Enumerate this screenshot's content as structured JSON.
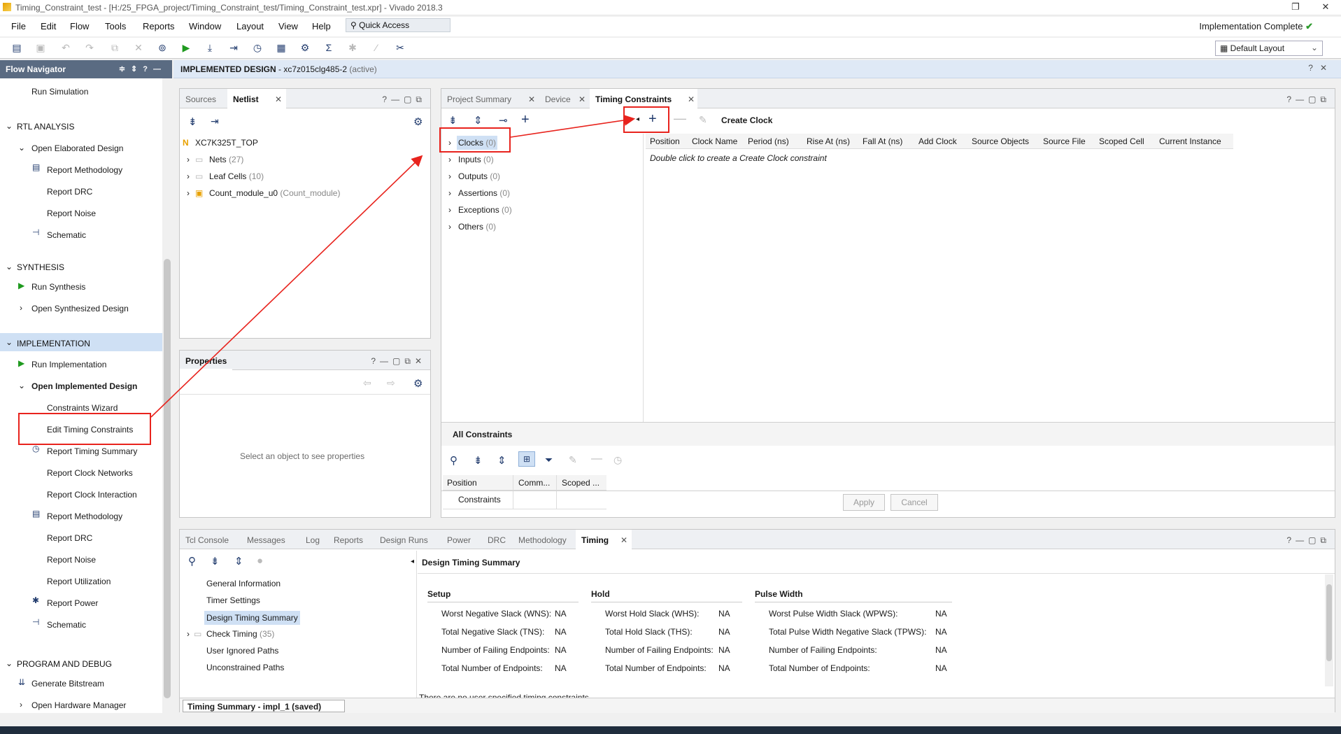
{
  "window": {
    "title": "Timing_Constraint_test - [H:/25_FPGA_project/Timing_Constraint_test/Timing_Constraint_test.xpr] - Vivado 2018.3",
    "restore_glyph": "❐",
    "close_glyph": "✕"
  },
  "menu": [
    "File",
    "Edit",
    "Flow",
    "Tools",
    "Reports",
    "Window",
    "Layout",
    "View",
    "Help"
  ],
  "quick_access": "Quick Access",
  "status": "Implementation Complete",
  "layout_select": "Default Layout",
  "flow_navigator": {
    "title": "Flow Navigator",
    "items": {
      "run_simulation": "Run Simulation",
      "rtl_analysis": "RTL ANALYSIS",
      "open_elaborated": "Open Elaborated Design",
      "rtl_report_methodology": "Report Methodology",
      "rtl_report_drc": "Report DRC",
      "rtl_report_noise": "Report Noise",
      "rtl_schematic": "Schematic",
      "synthesis": "SYNTHESIS",
      "run_synthesis": "Run Synthesis",
      "open_synthesized": "Open Synthesized Design",
      "implementation": "IMPLEMENTATION",
      "run_implementation": "Run Implementation",
      "open_implemented": "Open Implemented Design",
      "constraints_wizard": "Constraints Wizard",
      "edit_timing_constraints": "Edit Timing Constraints",
      "report_timing_summary": "Report Timing Summary",
      "report_clock_networks": "Report Clock Networks",
      "report_clock_interaction": "Report Clock Interaction",
      "impl_report_methodology": "Report Methodology",
      "impl_report_drc": "Report DRC",
      "impl_report_noise": "Report Noise",
      "report_utilization": "Report Utilization",
      "report_power": "Report Power",
      "impl_schematic": "Schematic",
      "program_debug": "PROGRAM AND DEBUG",
      "generate_bitstream": "Generate Bitstream",
      "open_hw_manager": "Open Hardware Manager"
    }
  },
  "design_header": {
    "label": "IMPLEMENTED DESIGN",
    "part": " - xc7z015clg485-2",
    "state": " (active)"
  },
  "sources_panel": {
    "tabs": [
      "Sources",
      "Netlist"
    ],
    "top": "XC7K325T_TOP",
    "nets": "Nets",
    "nets_count": "(27)",
    "leaf": "Leaf Cells",
    "leaf_count": "(10)",
    "module": "Count_module_u0",
    "module_sub": "(Count_module)"
  },
  "properties_panel": {
    "title": "Properties",
    "empty": "Select an object to see properties"
  },
  "timing_panel": {
    "tabs": [
      "Project Summary",
      "Device",
      "Timing Constraints"
    ],
    "create_clock": "Create Clock",
    "categories": [
      {
        "name": "Clocks",
        "count": "(0)"
      },
      {
        "name": "Inputs",
        "count": "(0)"
      },
      {
        "name": "Outputs",
        "count": "(0)"
      },
      {
        "name": "Assertions",
        "count": "(0)"
      },
      {
        "name": "Exceptions",
        "count": "(0)"
      },
      {
        "name": "Others",
        "count": "(0)"
      }
    ],
    "columns": [
      "Position",
      "Clock Name",
      "Period (ns)",
      "Rise At (ns)",
      "Fall At (ns)",
      "Add Clock",
      "Source Objects",
      "Source File",
      "Scoped Cell",
      "Current Instance"
    ],
    "hint": "Double click to create a Create Clock constraint",
    "all_constraints": "All Constraints",
    "ac_columns": [
      "Position",
      "Comm...",
      "Scoped ..."
    ],
    "ac_row": "Constraints",
    "apply": "Apply",
    "cancel": "Cancel"
  },
  "bottom_panel": {
    "tabs": [
      "Tcl Console",
      "Messages",
      "Log",
      "Reports",
      "Design Runs",
      "Power",
      "DRC",
      "Methodology",
      "Timing"
    ],
    "tree": {
      "general": "General Information",
      "timer": "Timer Settings",
      "summary": "Design Timing Summary",
      "check": "Check Timing",
      "check_count": "(35)",
      "ignored": "User Ignored Paths",
      "unconstrained": "Unconstrained Paths"
    },
    "report_title": "Design Timing Summary",
    "setup": {
      "title": "Setup",
      "rows": [
        [
          "Worst Negative Slack (WNS):",
          "NA"
        ],
        [
          "Total Negative Slack (TNS):",
          "NA"
        ],
        [
          "Number of Failing Endpoints:",
          "NA"
        ],
        [
          "Total Number of Endpoints:",
          "NA"
        ]
      ]
    },
    "hold": {
      "title": "Hold",
      "rows": [
        [
          "Worst Hold Slack (WHS):",
          "NA"
        ],
        [
          "Total Hold Slack (THS):",
          "NA"
        ],
        [
          "Number of Failing Endpoints:",
          "NA"
        ],
        [
          "Total Number of Endpoints:",
          "NA"
        ]
      ]
    },
    "pulse": {
      "title": "Pulse Width",
      "rows": [
        [
          "Worst Pulse Width Slack (WPWS):",
          "NA"
        ],
        [
          "Total Pulse Width Negative Slack (TPWS):",
          "NA"
        ],
        [
          "Number of Failing Endpoints:",
          "NA"
        ],
        [
          "Total Number of Endpoints:",
          "NA"
        ]
      ]
    },
    "partial_note": "There are no user specified timing constraints",
    "status_tab": "Timing Summary - impl_1 (saved)"
  },
  "colors": {
    "accent": "#e8231d",
    "header_blue": "#5a6b82",
    "selection": "#cfe0f4"
  }
}
